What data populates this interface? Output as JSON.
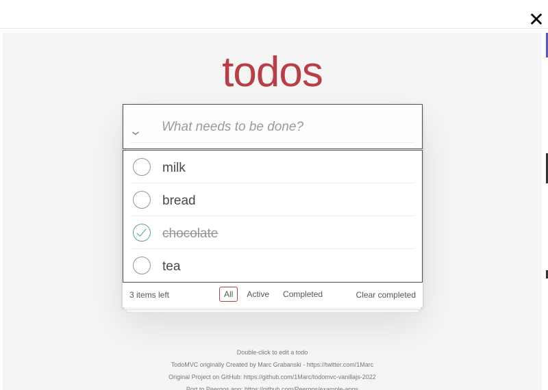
{
  "window": {
    "close_glyph": "✕"
  },
  "app": {
    "title": "todos"
  },
  "header": {
    "toggle_glyph": "⌄",
    "placeholder": "What needs to be done?",
    "value": ""
  },
  "todos": [
    {
      "title": "milk",
      "completed": false
    },
    {
      "title": "bread",
      "completed": false
    },
    {
      "title": "chocolate",
      "completed": true
    },
    {
      "title": "tea",
      "completed": false
    }
  ],
  "footer": {
    "count": "3 items left",
    "filters": [
      "All",
      "Active",
      "Completed"
    ],
    "selected_filter": "All",
    "clear_label": "Clear completed"
  },
  "info": {
    "hint": "Double-click to edit a todo",
    "credit": "TodoMVC originally Created by Marc Grabanski - https://twitter.com/1Marc",
    "original": "Original Project on GitHub: https://github.com/1Marc/todomvc-vanillajs-2022",
    "port": "Port to Peergos app: https://github.com/Peergos/example-apps"
  },
  "colors": {
    "accent": "#b83f45",
    "check": "#3ea390",
    "background": "#f5f5f5"
  },
  "icons": {
    "close": "close-icon",
    "toggle_all": "chevron-down-icon",
    "checkbox": "circle-checkbox-icon",
    "checked": "checkmark-icon"
  }
}
